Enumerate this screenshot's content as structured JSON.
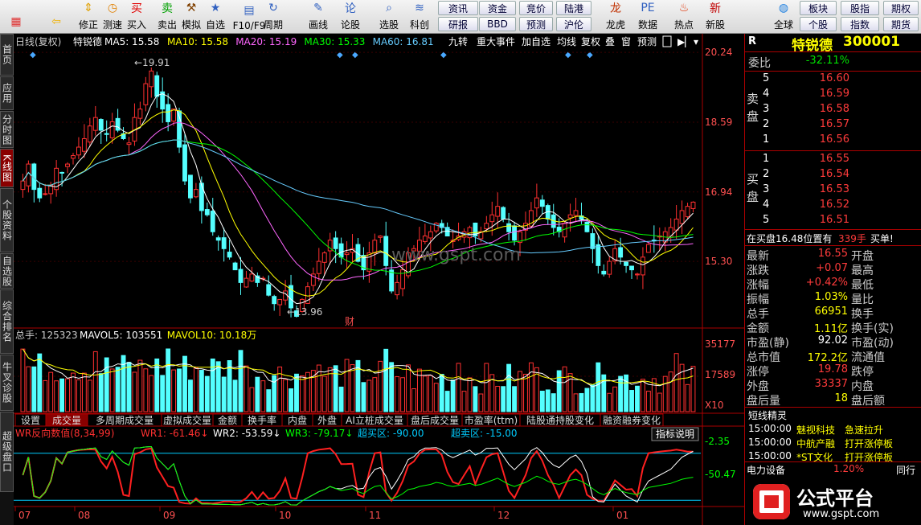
{
  "toolbar": {
    "buttons": [
      {
        "label": "",
        "icon": "home-icon",
        "color": "#e03030"
      },
      {
        "label": "",
        "icon": "back-arrow-icon",
        "color": "#f0b000"
      },
      {
        "label": "修正",
        "icon": "stepper-icon",
        "color": "#e0a000"
      },
      {
        "label": "测速",
        "icon": "stopwatch-icon",
        "color": "#e08000"
      },
      {
        "label": "买入",
        "icon": "buy-icon",
        "color": "#e00000"
      },
      {
        "label": "卖出",
        "icon": "sell-icon",
        "color": "#00a000"
      },
      {
        "label": "模拟",
        "icon": "hammer-icon",
        "color": "#804000"
      },
      {
        "label": "自选",
        "icon": "star-icon",
        "color": "#3060c0"
      },
      {
        "label": "F10/F9",
        "icon": "f10-icon",
        "color": "#3060c0"
      },
      {
        "label": "周期",
        "icon": "cycle-icon",
        "color": "#3060c0"
      },
      {
        "label": "画线",
        "icon": "pen-icon",
        "color": "#3060c0"
      },
      {
        "label": "论股",
        "icon": "discuss-icon",
        "color": "#3060c0"
      },
      {
        "label": "选股",
        "icon": "magnifier-icon",
        "color": "#3060c0"
      },
      {
        "label": "科创",
        "icon": "chart-icon",
        "color": "#3060c0"
      },
      {
        "label": "龙虎",
        "icon": "dragon-icon",
        "color": "#c03000"
      },
      {
        "label": "数据",
        "icon": "pe-icon",
        "color": "#3060c0"
      },
      {
        "label": "热点",
        "icon": "hot-icon",
        "color": "#e03000"
      },
      {
        "label": "新股",
        "icon": "newstock-icon",
        "color": "#c00000"
      },
      {
        "label": "全球",
        "icon": "globe-icon",
        "color": "#2080e0"
      }
    ],
    "small": [
      "资讯",
      "资金",
      "竞价",
      "陆港",
      "研报",
      "BBD",
      "预测",
      "沪伦",
      "板块",
      "股指",
      "期权",
      "个股",
      "指数",
      "期货"
    ]
  },
  "left_tabs": [
    "首页",
    "应用",
    "分时图",
    "K线图",
    "个股资料",
    "自选股",
    "综合排名",
    "牛叉诊股",
    "超级盘口"
  ],
  "chart": {
    "header": [
      {
        "text": "日线(复权)",
        "color": "#cccccc"
      },
      {
        "text": "特锐德",
        "color": "#ffffff"
      },
      {
        "text": "MA5: 15.58",
        "color": "#ffffff"
      },
      {
        "text": "MA10: 15.58",
        "color": "#ffff00"
      },
      {
        "text": "MA20: 15.19",
        "color": "#ff66ff"
      },
      {
        "text": "MA30: 15.33",
        "color": "#00ff00"
      },
      {
        "text": "MA60: 16.81",
        "color": "#66ccff"
      }
    ],
    "header_buttons": [
      "九转",
      "重大事件",
      "加自选",
      "均线",
      "复权",
      "叠",
      "窗",
      "预测"
    ],
    "price_axis": [
      "20.24",
      "18.59",
      "16.94",
      "15.30"
    ],
    "high_label": "19.91",
    "low_label": "13.96",
    "cai_label": "财",
    "watermark": "www.gspt.com",
    "vol_header": [
      {
        "text": "总手: 125323",
        "color": "#cccccc"
      },
      {
        "text": "MAVOL5: 103551",
        "color": "#ffffff"
      },
      {
        "text": "MAVOL10: 10.18万",
        "color": "#ffff00"
      }
    ],
    "vol_axis": [
      "35177",
      "17589",
      "X10"
    ],
    "sub_tabs": [
      "设置",
      "成交量",
      "多周期成交量",
      "虚拟成交量",
      "金额",
      "换手率",
      "内盘",
      "外盘",
      "AI立桩成交量",
      "盘后成交量",
      "市盈率(ttm)",
      "陆股通持股变化",
      "融资融券变化"
    ],
    "active_sub_tab": "成交量",
    "wr_header": [
      {
        "text": "WR反向数值(8,34,99)",
        "color": "#ff3030"
      },
      {
        "text": "WR1: -61.46↓",
        "color": "#ff3030"
      },
      {
        "text": "WR2: -53.59↓",
        "color": "#ffffff"
      },
      {
        "text": "WR3: -79.17↓",
        "color": "#00ff00"
      },
      {
        "text": "超买区: -90.00",
        "color": "#00ccff"
      },
      {
        "text": "超卖区: -15.00",
        "color": "#00ccff"
      }
    ],
    "indicator_btn": "指标说明",
    "wr_axis": [
      "-2.35",
      "-50.47"
    ],
    "months": [
      "07",
      "08",
      "09",
      "10",
      "11",
      "12",
      "01"
    ]
  },
  "chart_data": {
    "type": "candlestick",
    "price_range": [
      13.8,
      20.3
    ],
    "closes": [
      17.2,
      17.6,
      17.0,
      16.8,
      16.9,
      17.1,
      17.5,
      17.4,
      17.6,
      17.8,
      18.0,
      18.2,
      18.5,
      18.7,
      18.4,
      18.3,
      18.6,
      18.4,
      18.2,
      18.1,
      18.7,
      18.9,
      19.5,
      19.8,
      19.2,
      18.9,
      18.6,
      18.9,
      18.0,
      17.2,
      16.8,
      17.0,
      16.5,
      16.4,
      16.0,
      15.8,
      15.6,
      15.4,
      15.1,
      14.8,
      14.9,
      15.0,
      14.8,
      14.9,
      14.5,
      14.3,
      14.4,
      14.6,
      14.2,
      14.0,
      14.4,
      14.7,
      15.0,
      15.3,
      15.5,
      15.8,
      15.6,
      15.4,
      15.5,
      15.6,
      15.3,
      15.1,
      15.5,
      15.8,
      15.9,
      15.2,
      14.6,
      14.8,
      15.1,
      15.5,
      15.6,
      15.8,
      15.9,
      16.0,
      16.2,
      16.1,
      15.9,
      15.8,
      15.9,
      16.0,
      16.1,
      15.9,
      16.0,
      16.2,
      16.4,
      16.6,
      16.3,
      16.0,
      15.8,
      16.0,
      16.2,
      16.5,
      16.8,
      16.6,
      16.3,
      16.1,
      16.0,
      16.2,
      16.4,
      16.5,
      16.3,
      16.0,
      15.6,
      15.2,
      15.0,
      15.3,
      15.6,
      15.4,
      15.2,
      15.1,
      15.0,
      15.4,
      15.7,
      15.8,
      15.9,
      16.0,
      16.1,
      16.3,
      16.5,
      16.6,
      16.7
    ],
    "ma5_last": 15.58,
    "ma10_last": 15.58,
    "ma20_last": 15.19,
    "ma30_last": 15.33,
    "ma60_last": 16.81,
    "volume_max": 35177,
    "wr1": -61.46,
    "wr2": -53.59,
    "wr3": -79.17,
    "overbought": -90.0,
    "oversold": -15.0
  },
  "panel": {
    "r_label": "R",
    "name": "特锐德",
    "code": "300001",
    "webi_label": "委比",
    "webi_value": "-32.11%",
    "sell_label": "卖盘",
    "buy_label": "买盘",
    "asks": [
      {
        "lv": "5",
        "p": "16.60"
      },
      {
        "lv": "4",
        "p": "16.59"
      },
      {
        "lv": "3",
        "p": "16.58"
      },
      {
        "lv": "2",
        "p": "16.57"
      },
      {
        "lv": "1",
        "p": "16.56"
      }
    ],
    "bids": [
      {
        "lv": "1",
        "p": "16.55"
      },
      {
        "lv": "2",
        "p": "16.54"
      },
      {
        "lv": "3",
        "p": "16.53"
      },
      {
        "lv": "4",
        "p": "16.52"
      },
      {
        "lv": "5",
        "p": "16.51"
      }
    ],
    "notice": "在买盘16.48位置有",
    "notice_val": "339手",
    "notice_tail": "买单!",
    "stats": [
      {
        "l": "最新",
        "v": "16.55",
        "vc": "red",
        "r": "开盘"
      },
      {
        "l": "涨跌",
        "v": "+0.07",
        "vc": "red",
        "r": "最高"
      },
      {
        "l": "涨幅",
        "v": "+0.42%",
        "vc": "red",
        "r": "最低"
      },
      {
        "l": "振幅",
        "v": "1.03%",
        "vc": "yel",
        "r": "量比"
      },
      {
        "l": "总手",
        "v": "66951",
        "vc": "yel",
        "r": "换手"
      },
      {
        "l": "金额",
        "v": "1.11亿",
        "vc": "yel",
        "r": "换手(实)"
      },
      {
        "l": "市盈(静)",
        "v": "92.02",
        "vc": "wht",
        "r": "市盈(动)"
      },
      {
        "l": "总市值",
        "v": "172.2亿",
        "vc": "yel",
        "r": "流通值"
      },
      {
        "l": "涨停",
        "v": "19.78",
        "vc": "red",
        "r": "跌停"
      },
      {
        "l": "外盘",
        "v": "33337",
        "vc": "red",
        "r": "内盘"
      },
      {
        "l": "盘后量",
        "v": "18",
        "vc": "yel",
        "r": "盘后额"
      }
    ],
    "sprite_title": "短线精灵",
    "sprite": [
      {
        "t": "15:00:00",
        "n": "魅视科技",
        "e": "急速拉升"
      },
      {
        "t": "15:00:00",
        "n": "中航产融",
        "e": "打开涨停板"
      },
      {
        "t": "15:00:00",
        "n": "*ST文化",
        "e": "打开涨停板"
      }
    ],
    "sector": "电力设备",
    "sector_pct": "1.20%",
    "sector_tail": "同行",
    "logo_text": "公式平台",
    "logo_url": "www.gspt.com"
  }
}
